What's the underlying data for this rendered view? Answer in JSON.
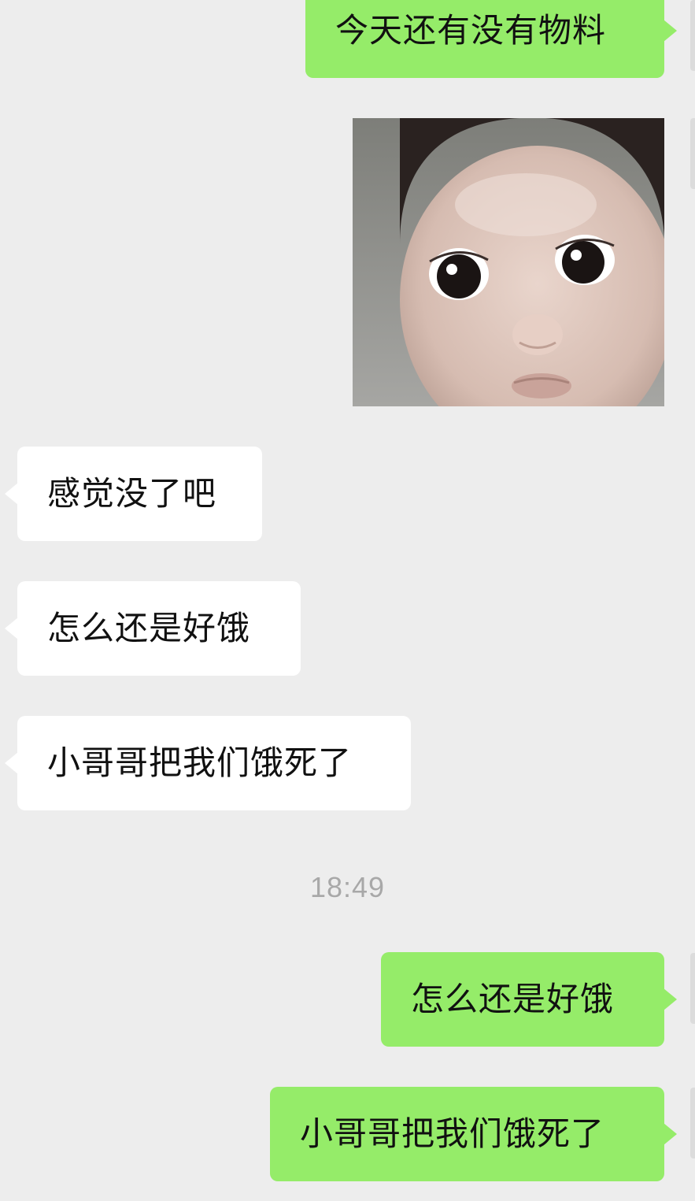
{
  "messages": [
    {
      "side": "outgoing",
      "text": "今天还有没有物料"
    },
    {
      "side": "outgoing",
      "type": "sticker",
      "sticker": "baby-face-sticker"
    },
    {
      "side": "incoming",
      "text": "感觉没了吧"
    },
    {
      "side": "incoming",
      "text": "怎么还是好饿"
    },
    {
      "side": "incoming",
      "text": "小哥哥把我们饿死了"
    },
    {
      "type": "time",
      "text": "18:49"
    },
    {
      "side": "outgoing",
      "text": "怎么还是好饿"
    },
    {
      "side": "outgoing",
      "text": "小哥哥把我们饿死了"
    }
  ],
  "colors": {
    "background": "#ededed",
    "outgoing_bubble": "#95ec69",
    "incoming_bubble": "#ffffff",
    "timestamp": "#a8a8a8"
  }
}
